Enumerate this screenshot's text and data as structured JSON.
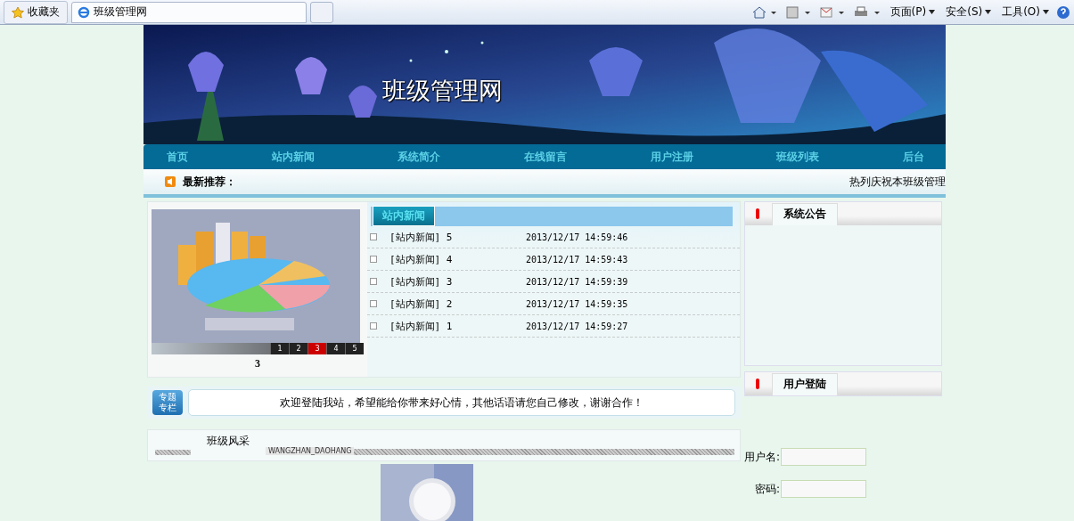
{
  "browser": {
    "favorites": "收藏夹",
    "tab_title": "班级管理网",
    "menus": [
      "页面(P)",
      "安全(S)",
      "工具(O)"
    ]
  },
  "site": {
    "title": "班级管理网",
    "nav": [
      "首页",
      "站内新闻",
      "系统简介",
      "在线留言",
      "用户注册",
      "班级列表",
      "后台"
    ],
    "ticker": {
      "label": "最新推荐：",
      "text": "热列庆祝本班级管理"
    }
  },
  "slideshow": {
    "pages": [
      {
        "label": "1",
        "selected": false
      },
      {
        "label": "2",
        "selected": false
      },
      {
        "label": "3",
        "selected": true
      },
      {
        "label": "4",
        "selected": false
      },
      {
        "label": "5",
        "selected": false
      }
    ],
    "caption": "3"
  },
  "news": {
    "tab": "站内新闻",
    "items": [
      {
        "title": "[站内新闻] 5",
        "time": "2013/12/17 14:59:46"
      },
      {
        "title": "[站内新闻] 4",
        "time": "2013/12/17 14:59:43"
      },
      {
        "title": "[站内新闻] 3",
        "time": "2013/12/17 14:59:39"
      },
      {
        "title": "[站内新闻] 2",
        "time": "2013/12/17 14:59:35"
      },
      {
        "title": "[站内新闻] 1",
        "time": "2013/12/17 14:59:27"
      }
    ]
  },
  "notice": {
    "badge_lines": [
      "专题",
      "专栏"
    ],
    "text": "欢迎登陆我站，希望能给你带来好心情，其他话语请您自己修改，谢谢合作！"
  },
  "gallery": {
    "title": "班级风采",
    "subtitle": "WANGZHAN_DAOHANG"
  },
  "sidebar": {
    "announcements": {
      "title": "系统公告"
    },
    "login": {
      "title": "用户登陆",
      "fields": [
        {
          "label": "用户名:"
        },
        {
          "label": "密码:"
        }
      ]
    }
  }
}
